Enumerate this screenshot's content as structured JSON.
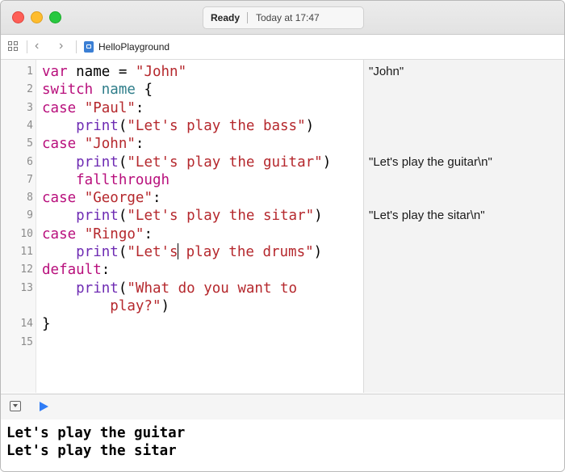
{
  "window": {
    "status": "Ready",
    "timestamp": "Today at 17:47"
  },
  "jumpbar": {
    "file_name": "HelloPlayground",
    "nav_back": "‹",
    "nav_forward": "›"
  },
  "editor": {
    "line_numbers": [
      "1",
      "2",
      "3",
      "4",
      "5",
      "6",
      "7",
      "8",
      "9",
      "10",
      "11",
      "12",
      "13",
      "14",
      "15"
    ],
    "lines": [
      [
        {
          "t": "var",
          "c": "kw"
        },
        {
          "t": " name = ",
          "c": "plain"
        },
        {
          "t": "\"John\"",
          "c": "str"
        }
      ],
      [
        {
          "t": "switch",
          "c": "kw"
        },
        {
          "t": " ",
          "c": "plain"
        },
        {
          "t": "name",
          "c": "ident"
        },
        {
          "t": " {",
          "c": "plain"
        }
      ],
      [
        {
          "t": "case",
          "c": "kw"
        },
        {
          "t": " ",
          "c": "plain"
        },
        {
          "t": "\"Paul\"",
          "c": "str"
        },
        {
          "t": ":",
          "c": "plain"
        }
      ],
      [
        {
          "t": "    print",
          "c": "fn"
        },
        {
          "t": "(",
          "c": "plain"
        },
        {
          "t": "\"Let's play the bass\"",
          "c": "str"
        },
        {
          "t": ")",
          "c": "plain"
        }
      ],
      [
        {
          "t": "case",
          "c": "kw"
        },
        {
          "t": " ",
          "c": "plain"
        },
        {
          "t": "\"John\"",
          "c": "str"
        },
        {
          "t": ":",
          "c": "plain"
        }
      ],
      [
        {
          "t": "    print",
          "c": "fn"
        },
        {
          "t": "(",
          "c": "plain"
        },
        {
          "t": "\"Let's play the guitar\"",
          "c": "str"
        },
        {
          "t": ")",
          "c": "plain"
        }
      ],
      [
        {
          "t": "    fallthrough",
          "c": "kw"
        }
      ],
      [
        {
          "t": "case",
          "c": "kw"
        },
        {
          "t": " ",
          "c": "plain"
        },
        {
          "t": "\"George\"",
          "c": "str"
        },
        {
          "t": ":",
          "c": "plain"
        }
      ],
      [
        {
          "t": "    print",
          "c": "fn"
        },
        {
          "t": "(",
          "c": "plain"
        },
        {
          "t": "\"Let's play the sitar\"",
          "c": "str"
        },
        {
          "t": ")",
          "c": "plain"
        }
      ],
      [
        {
          "t": "case",
          "c": "kw"
        },
        {
          "t": " ",
          "c": "plain"
        },
        {
          "t": "\"Ringo\"",
          "c": "str"
        },
        {
          "t": ":",
          "c": "plain"
        }
      ],
      [
        {
          "t": "    print",
          "c": "fn"
        },
        {
          "t": "(",
          "c": "plain"
        },
        {
          "t": "\"Let's",
          "c": "str"
        },
        {
          "t": "|",
          "c": "cursor"
        },
        {
          "t": " play the drums\"",
          "c": "str"
        },
        {
          "t": ")",
          "c": "plain"
        }
      ],
      [
        {
          "t": "default",
          "c": "kw"
        },
        {
          "t": ":",
          "c": "plain"
        }
      ],
      [
        {
          "t": "    print",
          "c": "fn"
        },
        {
          "t": "(",
          "c": "plain"
        },
        {
          "t": "\"What do you want to",
          "c": "str"
        }
      ],
      [
        {
          "t": "        play?\"",
          "c": "str"
        },
        {
          "t": ")",
          "c": "plain"
        }
      ],
      [
        {
          "t": "}",
          "c": "plain"
        }
      ]
    ]
  },
  "results": [
    "\"John\"",
    "\"Let's play the guitar\\n\"",
    "\"Let's play the sitar\\n\""
  ],
  "console": {
    "output": [
      "Let's play the guitar",
      "Let's play the sitar"
    ]
  },
  "colors": {
    "keyword": "#b80f7c",
    "string": "#b5282d",
    "identifier": "#2f7e8a",
    "function": "#6e2bb3",
    "run_button": "#2f7cf6"
  }
}
